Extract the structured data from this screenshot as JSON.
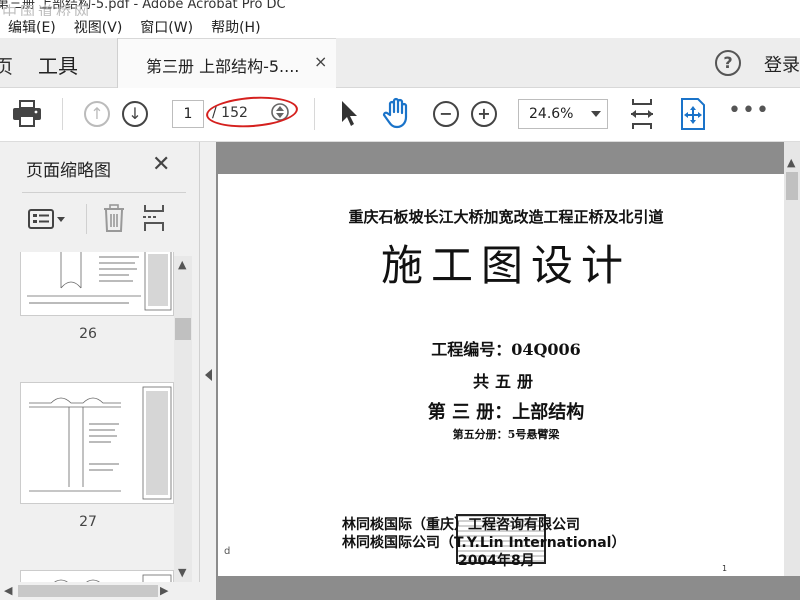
{
  "titlebar": {
    "title": "第三册 上部结构-5.pdf - Adobe Acrobat Pro DC",
    "watermark": "中国道桥网"
  },
  "menu": [
    "编辑(E)",
    "视图(V)",
    "窗口(W)",
    "帮助(H)"
  ],
  "tabs": {
    "home": "页",
    "tools": "工具",
    "doc": "第三册 上部结构-5....",
    "close": "×",
    "login": "登录"
  },
  "toolbar": {
    "page_current": "1",
    "page_total": "/ 152",
    "zoom": "24.6%",
    "more": "•••"
  },
  "sidebar": {
    "title": "页面缩略图",
    "close": "✕",
    "thumbs": [
      {
        "label": "26"
      },
      {
        "label": "27"
      }
    ]
  },
  "document": {
    "line1": "重庆石板坡长江大桥加宽改造工程正桥及北引道",
    "title": "施工图设计",
    "project_no": "工程编号：04Q006",
    "volumes": "共五册",
    "volume": "第 三 册：上部结构",
    "sub": "第五分册：5号悬臂梁",
    "company1": "林同棪国际（重庆）工程咨询有限公司",
    "company2": "林同棪国际公司（T.Y.Lin International）",
    "date": "2004年8月",
    "page_no": "1",
    "mark": "d"
  },
  "colors": {
    "annotation": "#d5201e",
    "accent": "#1a73c9",
    "doc_bg": "#8c8c8c"
  }
}
